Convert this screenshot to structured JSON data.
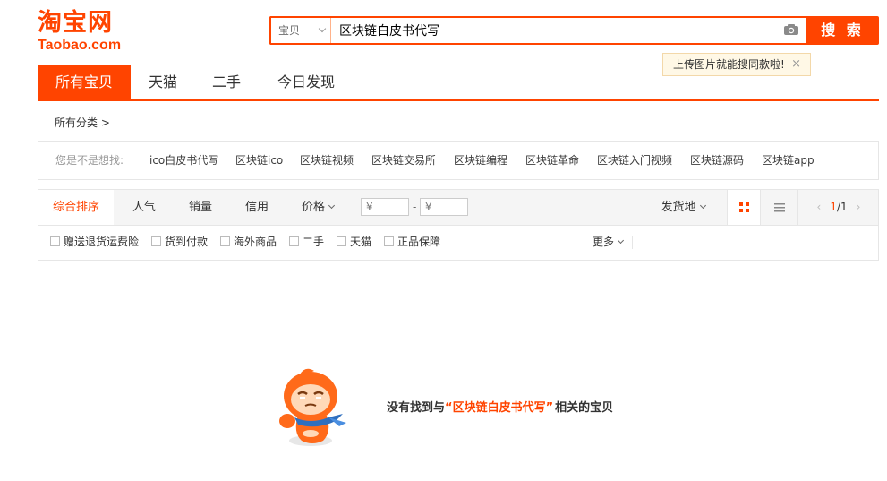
{
  "logo": {
    "cn": "淘宝网",
    "en": "Taobao.com"
  },
  "search": {
    "type_label": "宝贝",
    "query": "区块链白皮书代写",
    "button_label": "搜 索",
    "image_tip": "上传图片就能搜同款啦!",
    "tip_close": "×"
  },
  "nav": {
    "tabs": [
      {
        "label": "所有宝贝",
        "active": true
      },
      {
        "label": "天猫"
      },
      {
        "label": "二手"
      },
      {
        "label": "今日发现"
      }
    ]
  },
  "category": {
    "label": "所有分类 >"
  },
  "suggest": {
    "label": "您是不是想找:",
    "items": [
      "ico白皮书代写",
      "区块链ico",
      "区块链视频",
      "区块链交易所",
      "区块链编程",
      "区块链革命",
      "区块链入门视频",
      "区块链源码",
      "区块链app"
    ]
  },
  "sort": {
    "items": [
      "综合排序",
      "人气",
      "销量",
      "信用",
      "价格"
    ],
    "price_placeholder": "¥",
    "price_dash": "-",
    "location": "发货地",
    "page_current": "1",
    "page_sep": "/",
    "page_total": "1"
  },
  "filters": {
    "items": [
      "赠送退货运费险",
      "货到付款",
      "海外商品",
      "二手",
      "天猫",
      "正品保障"
    ],
    "more": "更多"
  },
  "empty": {
    "prefix": "没有找到与",
    "open_quote": "“",
    "keyword": "区块链白皮书代写",
    "close_quote": "”",
    "suffix": "相关的宝贝"
  },
  "colors": {
    "brand": "#ff4400",
    "tip_bg": "#fff8e6"
  }
}
